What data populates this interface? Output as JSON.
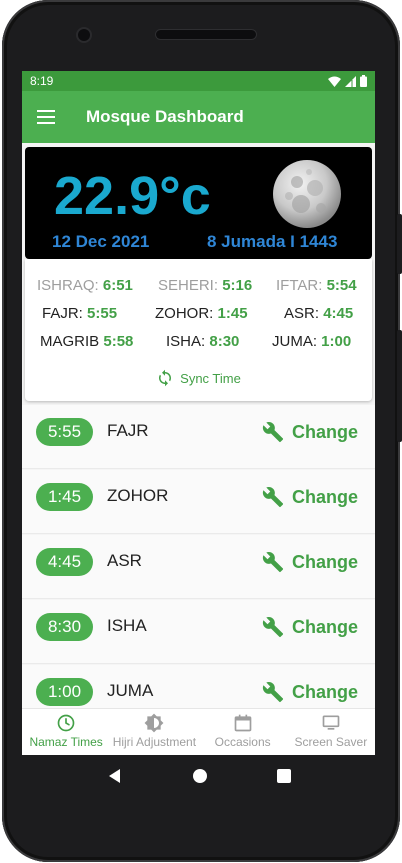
{
  "status_bar": {
    "time": "8:19"
  },
  "app_bar": {
    "title": "Mosque Dashboard",
    "menu_icon": "hamburger-menu-icon"
  },
  "hero": {
    "temperature": "22.9°c",
    "gregorian_date": "12 Dec 2021",
    "hijri_date": "8 Jumada I 1443",
    "moon_icon": "moon-image"
  },
  "timings": {
    "rows": [
      [
        {
          "label": "ISHRAQ:",
          "value": "6:51",
          "muted": true
        },
        {
          "label": "SEHERI:",
          "value": "5:16",
          "muted": true
        },
        {
          "label": "IFTAR:",
          "value": "5:54",
          "muted": true
        }
      ],
      [
        {
          "label": "FAJR:",
          "value": "5:55"
        },
        {
          "label": "ZOHOR:",
          "value": "1:45"
        },
        {
          "label": "ASR:",
          "value": "4:45"
        }
      ],
      [
        {
          "label": "MAGRIB",
          "value": "5:58"
        },
        {
          "label": "ISHA:",
          "value": "8:30"
        },
        {
          "label": "JUMA:",
          "value": "1:00"
        }
      ]
    ],
    "sync_label": "Sync Time"
  },
  "prayers": [
    {
      "time": "5:55",
      "name": "FAJR",
      "action": "Change"
    },
    {
      "time": "1:45",
      "name": "ZOHOR",
      "action": "Change"
    },
    {
      "time": "4:45",
      "name": "ASR",
      "action": "Change"
    },
    {
      "time": "8:30",
      "name": "ISHA",
      "action": "Change"
    },
    {
      "time": "1:00",
      "name": "JUMA",
      "action": "Change"
    }
  ],
  "bottom_nav": [
    {
      "label": "Namaz Times",
      "icon": "clock-icon",
      "active": true
    },
    {
      "label": "Hijri Adjustment",
      "icon": "brightness-icon",
      "active": false
    },
    {
      "label": "Occasions",
      "icon": "calendar-icon",
      "active": false
    },
    {
      "label": "Screen Saver",
      "icon": "monitor-icon",
      "active": false
    }
  ],
  "colors": {
    "primary": "#4caf50",
    "primary_dark": "#3c9a3c",
    "accent_text": "#43a047",
    "temperature": "#1aa9cf",
    "date": "#2f86d6"
  }
}
